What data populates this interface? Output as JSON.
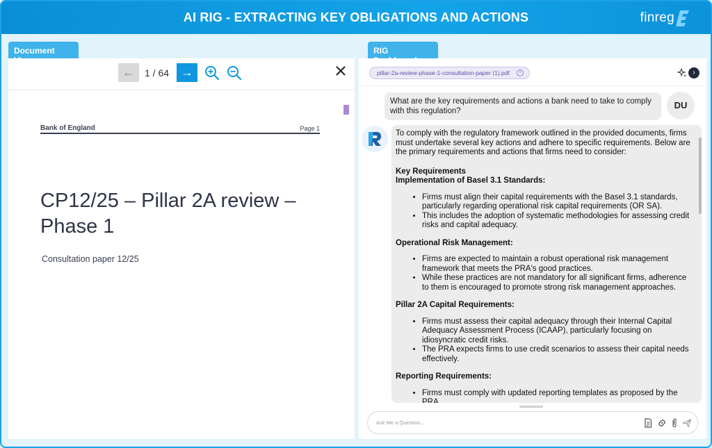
{
  "app": {
    "title": "AI RIG - EXTRACTING KEY OBLIGATIONS AND ACTIONS",
    "logo_text": "finreg",
    "logo_mark": "E"
  },
  "document_view": {
    "tab_label": "Document View",
    "prev_symbol": "←",
    "next_symbol": "→",
    "page_indicator": "1 / 64",
    "pdf": {
      "org": "Bank of England",
      "page_label": "Page 1",
      "title": "CP12/25 – Pillar 2A review – Phase 1",
      "subtitle": "Consultation paper 12/25"
    }
  },
  "rig_dashboard": {
    "tab_label": "RIG Dashboard",
    "file_chip": "pillar-2a-review-phase-1-consultation-paper (1).pdf",
    "user_avatar": "DU",
    "question": "What are the key requirements and actions a bank need to take to comply with this regulation?",
    "answer": {
      "intro": "To comply with the regulatory framework outlined in the provided documents, firms must undertake several key actions and adhere to specific requirements. Below are the primary requirements and actions that firms need to consider:",
      "heading": "Key Requirements",
      "sections": [
        {
          "title": "Implementation of Basel 3.1 Standards:",
          "items": [
            "Firms must align their capital requirements with the Basel 3.1 standards, particularly regarding operational risk capital requirements (OR SA).",
            "This includes the adoption of systematic methodologies for assessing credit risks and capital adequacy."
          ]
        },
        {
          "title": "Operational Risk Management:",
          "items": [
            "Firms are expected to maintain a robust operational risk management framework that meets the PRA's good practices.",
            "While these practices are not mandatory for all significant firms, adherence to them is encouraged to promote strong risk management approaches."
          ]
        },
        {
          "title": "Pillar 2A Capital Requirements:",
          "items": [
            "Firms must assess their capital adequacy through their Internal Capital Adequacy Assessment Process (ICAAP), particularly focusing on idiosyncratic credit risks.",
            "The PRA expects firms to use credit scenarios to assess their capital needs effectively."
          ]
        },
        {
          "title": "Reporting Requirements:",
          "items": [
            "Firms must comply with updated reporting templates as proposed by the PRA"
          ]
        }
      ]
    },
    "ask_placeholder": "Ask Me a Question..."
  },
  "colors": {
    "header": "#0e97e0",
    "tab": "#3fb3ea",
    "chip_bg": "#eceaf7",
    "chip_text": "#5b4fa8"
  },
  "icons": [
    "zoom-in-icon",
    "zoom-out-icon",
    "close-icon",
    "sparkle-icon",
    "arrow-right-circle-icon",
    "document-icon",
    "link-icon",
    "paperclip-icon",
    "send-icon",
    "rig-logo-icon"
  ]
}
